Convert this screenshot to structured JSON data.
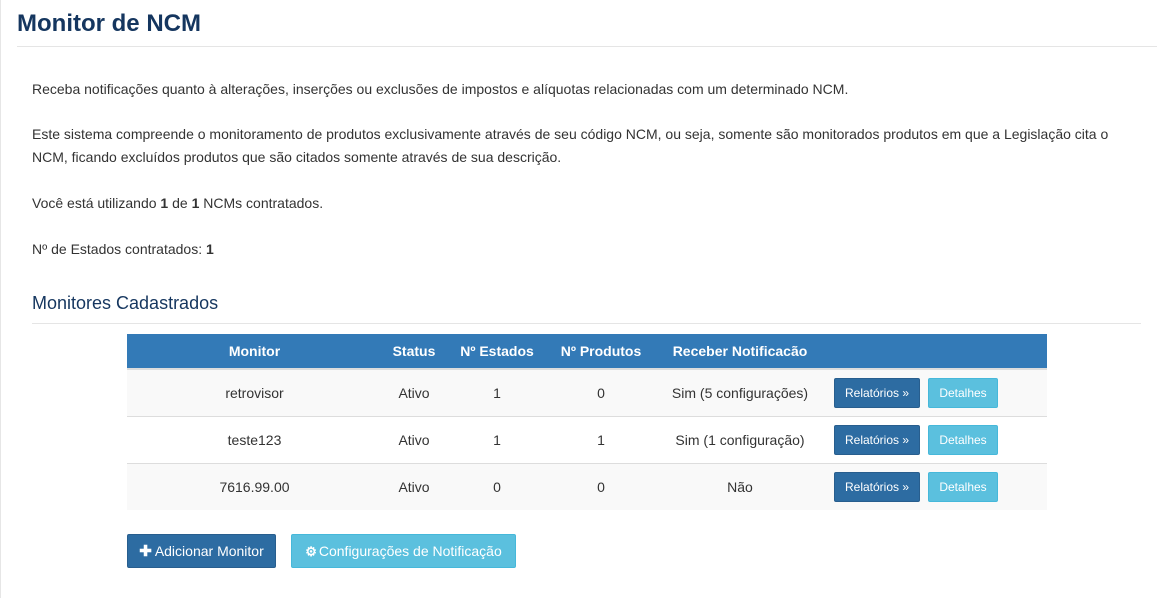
{
  "page": {
    "title": "Monitor de NCM"
  },
  "intro": {
    "p1": "Receba notificações quanto à alterações, inserções ou exclusões de impostos e alíquotas relacionadas com um determinado NCM.",
    "p2": "Este sistema compreende o monitoramento de produtos exclusivamente através de seu código NCM, ou seja, somente são monitorados produtos em que a Legislação cita o NCM, ficando excluídos produtos que são citados somente através de sua descrição.",
    "usage_prefix": "Você está utilizando ",
    "usage_used": "1",
    "usage_mid": " de ",
    "usage_total": "1",
    "usage_suffix": " NCMs contratados.",
    "states_prefix": "Nº de Estados contratados: ",
    "states_count": "1"
  },
  "section": {
    "title": "Monitores Cadastrados"
  },
  "table": {
    "headers": {
      "monitor": "Monitor",
      "status": "Status",
      "states": "Nº Estados",
      "products": "Nº Produtos",
      "notify": "Receber Notificacão",
      "actions": ""
    },
    "rows": [
      {
        "monitor": "retrovisor",
        "status": "Ativo",
        "states": "1",
        "products": "0",
        "notify": "Sim (5 configurações)",
        "reports_label": "Relatórios »",
        "details_label": "Detalhes"
      },
      {
        "monitor": "teste123",
        "status": "Ativo",
        "states": "1",
        "products": "1",
        "notify": "Sim (1 configuração)",
        "reports_label": "Relatórios »",
        "details_label": "Detalhes"
      },
      {
        "monitor": "7616.99.00",
        "status": "Ativo",
        "states": "0",
        "products": "0",
        "notify": "Não",
        "reports_label": "Relatórios »",
        "details_label": "Detalhes"
      }
    ]
  },
  "actions": {
    "add_icon": "plus-icon",
    "add_label": "Adicionar Monitor",
    "config_icon": "gear-icon",
    "config_label": "Configurações de Notificação"
  },
  "colors": {
    "title": "#15365f",
    "primary": "#337ab7",
    "info": "#5bc0de"
  }
}
